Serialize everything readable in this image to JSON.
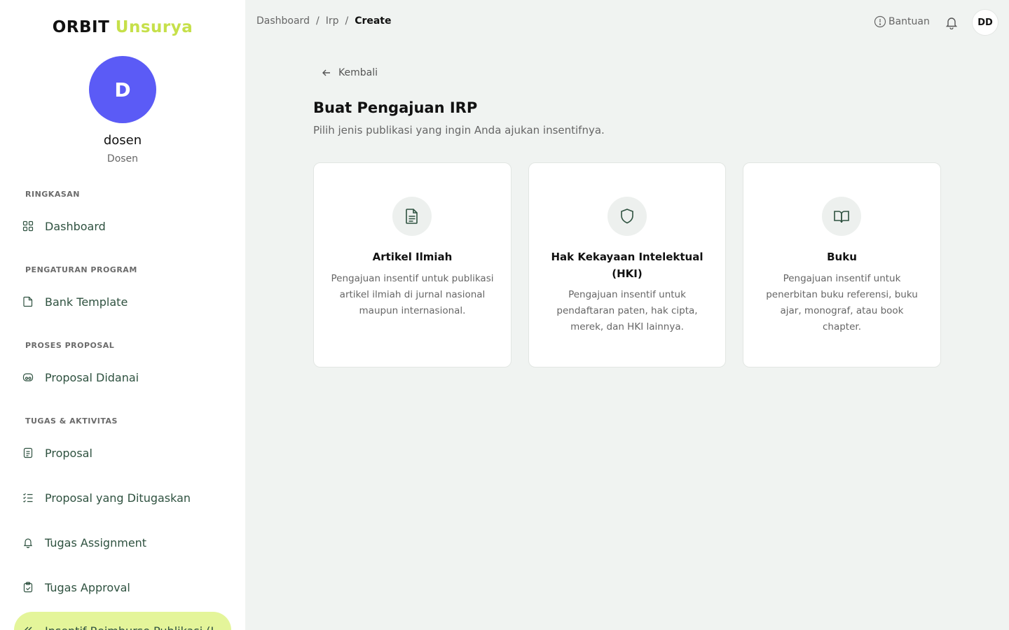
{
  "brand": {
    "part1": "ORBIT",
    "part2": "Unsurya"
  },
  "user": {
    "initial": "D",
    "name": "dosen",
    "role": "Dosen"
  },
  "sidebar": {
    "sections": [
      {
        "label": "RINGKASAN"
      },
      {
        "label": "PENGATURAN PROGRAM"
      },
      {
        "label": "PROSES PROPOSAL"
      },
      {
        "label": "TUGAS & AKTIVITAS"
      }
    ],
    "items": [
      {
        "label": "Dashboard",
        "icon": "grid-icon"
      },
      {
        "label": "Bank Template",
        "icon": "folder-icon"
      },
      {
        "label": "Proposal Didanai",
        "icon": "funding-icon"
      },
      {
        "label": "Proposal",
        "icon": "document-icon"
      },
      {
        "label": "Proposal yang Ditugaskan",
        "icon": "list-check-icon"
      },
      {
        "label": "Tugas Assignment",
        "icon": "bell-icon"
      },
      {
        "label": "Tugas Approval",
        "icon": "clipboard-check-icon"
      },
      {
        "label": "Insentif Reimburse Publikasi (I",
        "icon": "double-chevron-icon"
      }
    ]
  },
  "breadcrumb": {
    "items": [
      "Dashboard",
      "Irp"
    ],
    "current": "Create"
  },
  "topbar": {
    "help_label": "Bantuan",
    "avatar_initials": "DD"
  },
  "main": {
    "back_label": "Kembali",
    "title": "Buat Pengajuan IRP",
    "subtitle": "Pilih jenis publikasi yang ingin Anda ajukan insentifnya.",
    "cards": [
      {
        "title": "Artikel Ilmiah",
        "description": "Pengajuan insentif untuk publikasi artikel ilmiah di jurnal nasional maupun internasional.",
        "icon": "document-icon"
      },
      {
        "title": "Hak Kekayaan Intelektual (HKI)",
        "description": "Pengajuan insentif untuk pendaftaran paten, hak cipta, merek, dan HKI lainnya.",
        "icon": "shield-icon"
      },
      {
        "title": "Buku",
        "description": "Pengajuan insentif untuk penerbitan buku referensi, buku ajar, monograf, atau book chapter.",
        "icon": "book-open-icon"
      }
    ]
  },
  "colors": {
    "accent": "#c6e04a",
    "avatar": "#5b5bf6",
    "nav_text": "#2f5240",
    "active_bg": "#e4f59a"
  }
}
